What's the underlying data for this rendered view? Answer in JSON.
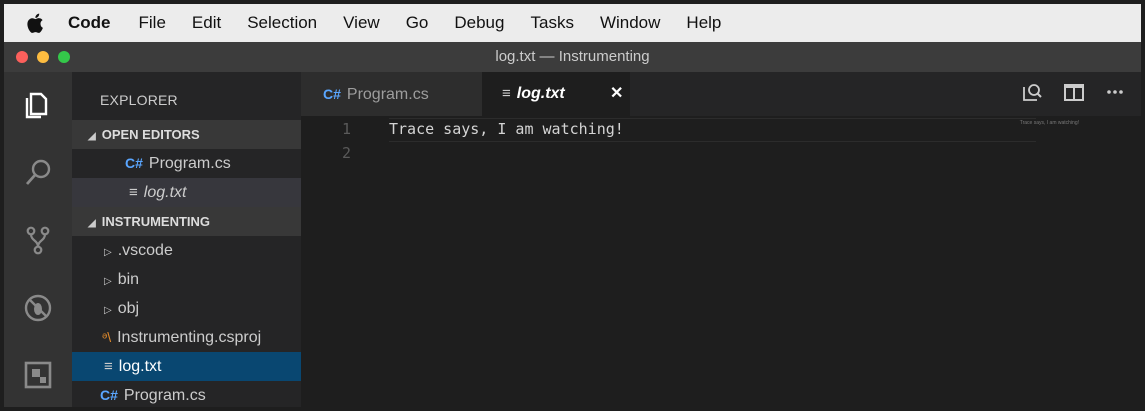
{
  "menubar": {
    "app": "Code",
    "items": [
      "File",
      "Edit",
      "Selection",
      "View",
      "Go",
      "Debug",
      "Tasks",
      "Window",
      "Help"
    ]
  },
  "titlebar": {
    "title": "log.txt — Instrumenting",
    "lights": [
      "#fc605c",
      "#fdbc40",
      "#34c84a"
    ]
  },
  "activity_bar": {
    "icons": [
      "files-icon",
      "search-icon",
      "source-control-icon",
      "debug-icon",
      "extensions-icon"
    ]
  },
  "sidebar": {
    "header": "EXPLORER",
    "open_editors": {
      "label": "OPEN EDITORS",
      "items": [
        {
          "name": "Program.cs",
          "icon": "csharp-icon"
        },
        {
          "name": "log.txt",
          "icon": "text-file-icon"
        }
      ]
    },
    "folder": {
      "label": "INSTRUMENTING",
      "items": [
        {
          "name": ".vscode",
          "type": "folder"
        },
        {
          "name": "bin",
          "type": "folder"
        },
        {
          "name": "obj",
          "type": "folder"
        },
        {
          "name": "Instrumenting.csproj",
          "type": "file",
          "icon": "rss-icon"
        },
        {
          "name": "log.txt",
          "type": "file",
          "icon": "text-file-icon"
        },
        {
          "name": "Program.cs",
          "type": "file",
          "icon": "csharp-icon"
        }
      ]
    }
  },
  "tabs": [
    {
      "label": "Program.cs",
      "active": false
    },
    {
      "label": "log.txt",
      "active": true
    }
  ],
  "editor": {
    "lines": [
      "Trace says, I am watching!",
      ""
    ],
    "line_numbers": [
      "1",
      "2"
    ]
  },
  "colors": {
    "accent_selected": "#094771",
    "csharp": "#5aa6ff",
    "rss": "#e08a2c"
  }
}
